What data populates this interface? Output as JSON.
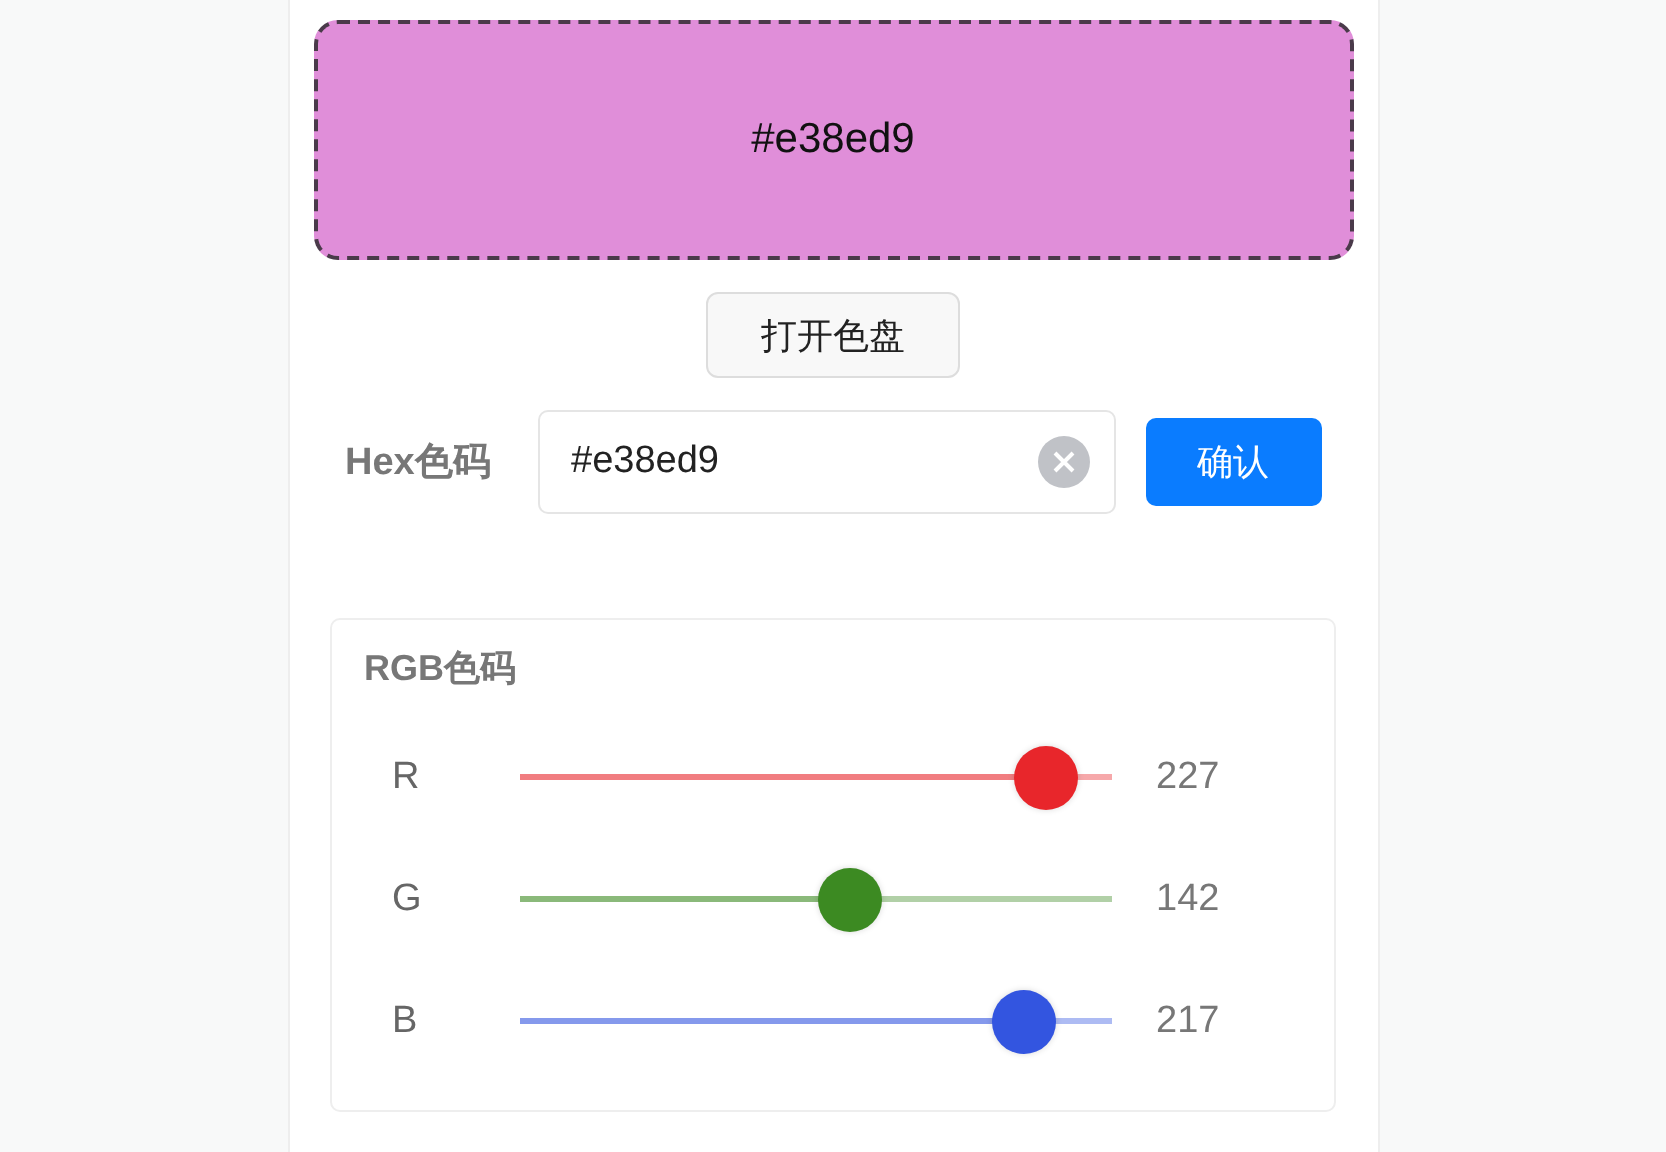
{
  "swatch": {
    "label": "#e38ed9",
    "color": "#e08ed9"
  },
  "open_button": "打开色盘",
  "hex": {
    "label": "Hex色码",
    "value": "#e38ed9",
    "confirm": "确认"
  },
  "rgb": {
    "title": "RGB色码",
    "channels": [
      {
        "name": "R",
        "level": 0.89,
        "reading": "227",
        "color": "#e8262b"
      },
      {
        "name": "G",
        "level": 0.557,
        "reading": "142",
        "color": "#3c8a22"
      },
      {
        "name": "B",
        "level": 0.851,
        "reading": "217",
        "color": "#3355e0"
      }
    ]
  }
}
